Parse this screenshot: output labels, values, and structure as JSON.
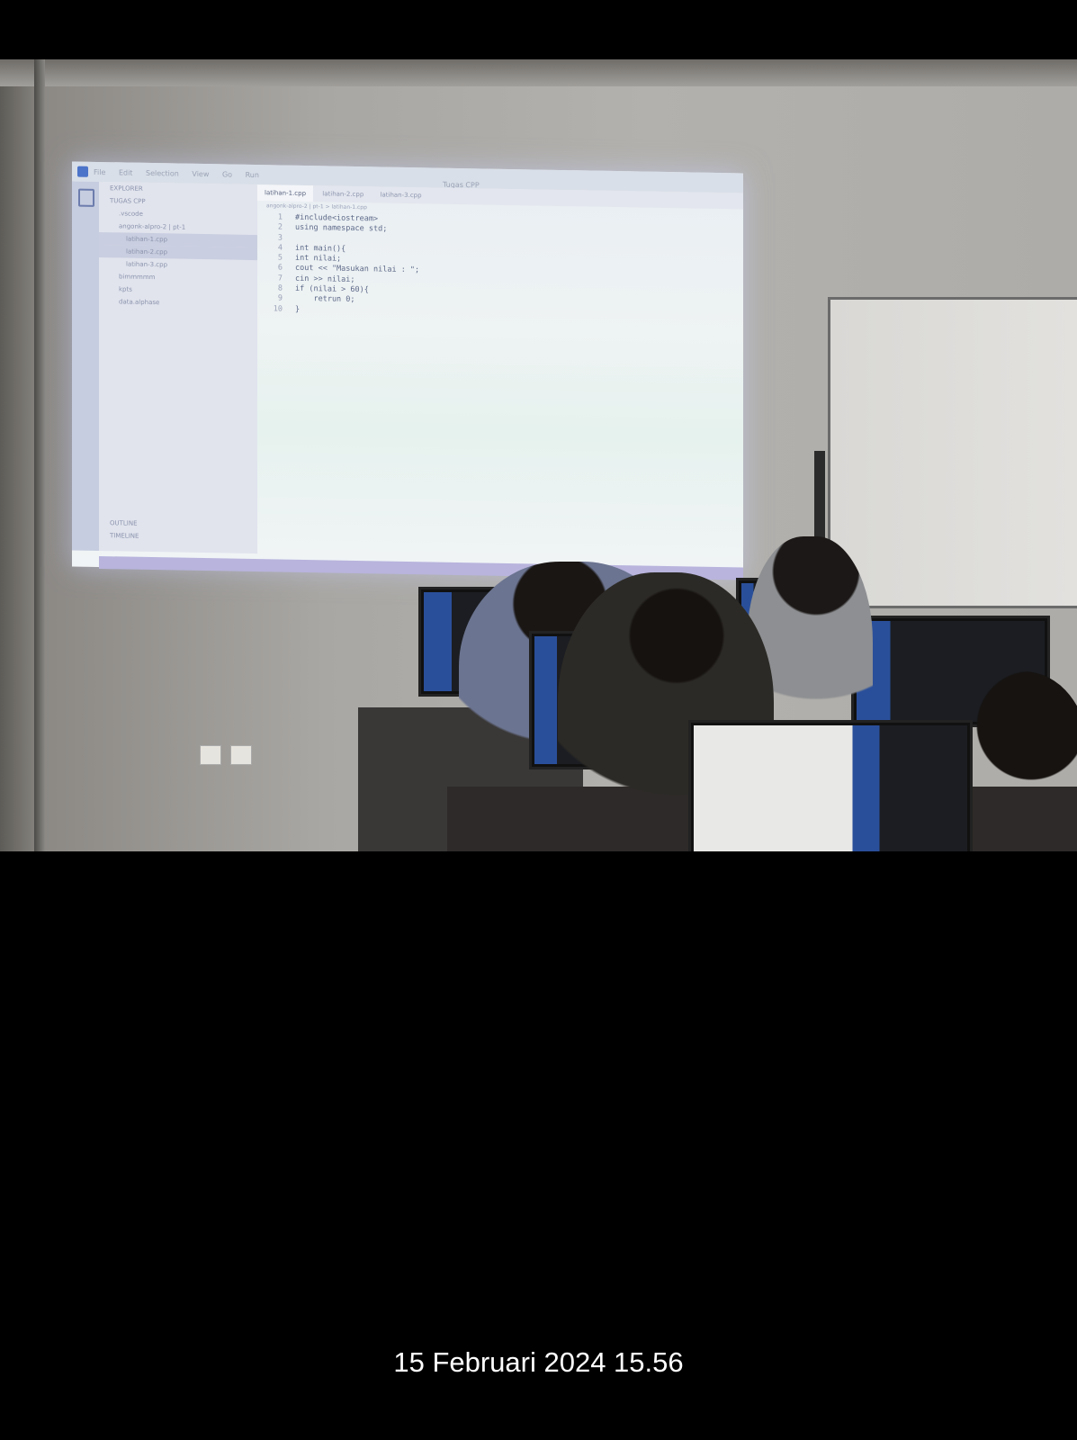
{
  "projection": {
    "menu": [
      "File",
      "Edit",
      "Selection",
      "View",
      "Go",
      "Run"
    ],
    "window_title": "Tugas CPP",
    "sidebar": {
      "header": "EXPLORER",
      "folder": "TUGAS CPP",
      "items": [
        ".vscode",
        "angonk-alpro-2 | pt-1",
        "latihan-1.cpp",
        "latihan-2.cpp",
        "latihan-3.cpp",
        "bimmmmm",
        "kpts",
        "data.alphase"
      ],
      "outline": "OUTLINE",
      "timeline": "TIMELINE"
    },
    "tabs": [
      "latihan-1.cpp",
      "latihan-2.cpp",
      "latihan-3.cpp"
    ],
    "breadcrumb": "angonk-alpro-2 | pt-1 > latihan-1.cpp",
    "code": [
      "#include<iostream>",
      "using namespace std;",
      "",
      "int main(){",
      "int nilai;",
      "cout << \"Masukan nilai : \";",
      "cin >> nilai;",
      "if (nilai > 60){",
      "    retrun 0;",
      "}"
    ],
    "line_numbers": [
      "1",
      "2",
      "3",
      "4",
      "5",
      "6",
      "7",
      "8",
      "9",
      "10"
    ]
  },
  "timestamp": "15 Februari 2024 15.56"
}
